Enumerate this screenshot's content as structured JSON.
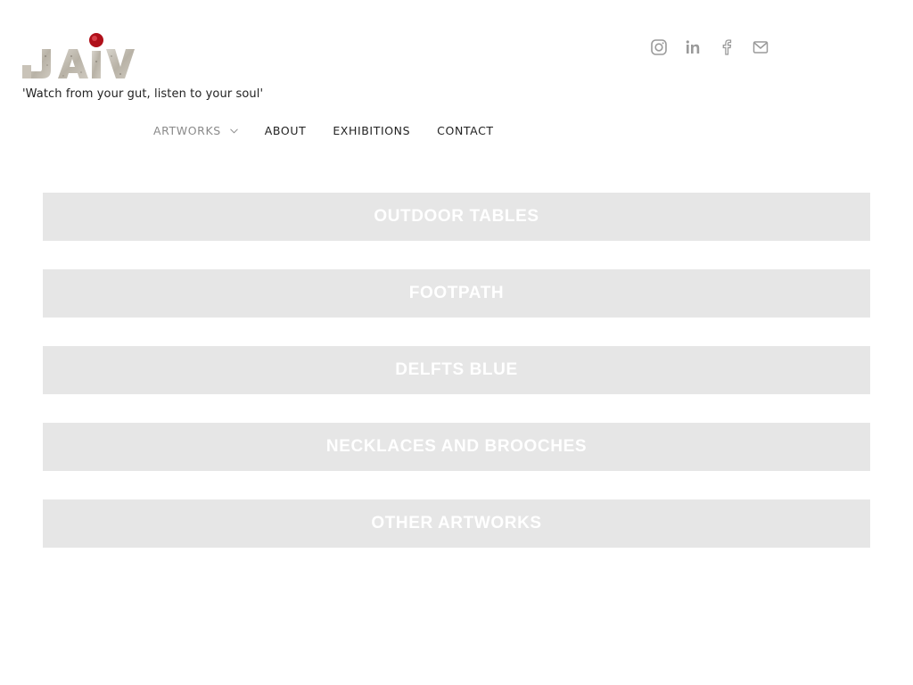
{
  "header": {
    "logo_text": "JAIV",
    "tagline": "'Watch from your gut, listen to your soul'"
  },
  "social": [
    {
      "name": "instagram-icon"
    },
    {
      "name": "linkedin-icon"
    },
    {
      "name": "facebook-icon"
    },
    {
      "name": "email-icon"
    }
  ],
  "nav": {
    "artworks": "ARTWORKS",
    "about": "ABOUT",
    "exhibitions": "EXHIBITIONS",
    "contact": "CONTACT"
  },
  "categories": [
    "OUTDOOR TABLES",
    "FOOTPATH",
    "DELFTS BLUE",
    "NECKLACES AND BROOCHES",
    "OTHER ARTWORKS"
  ],
  "colors": {
    "category_bg": "#e6e6e6",
    "category_text": "#ffffff",
    "nav_active": "#8a8a8a",
    "nav_text": "#222222",
    "icon": "#9a9a9a",
    "logo_dot": "#b0101a"
  }
}
